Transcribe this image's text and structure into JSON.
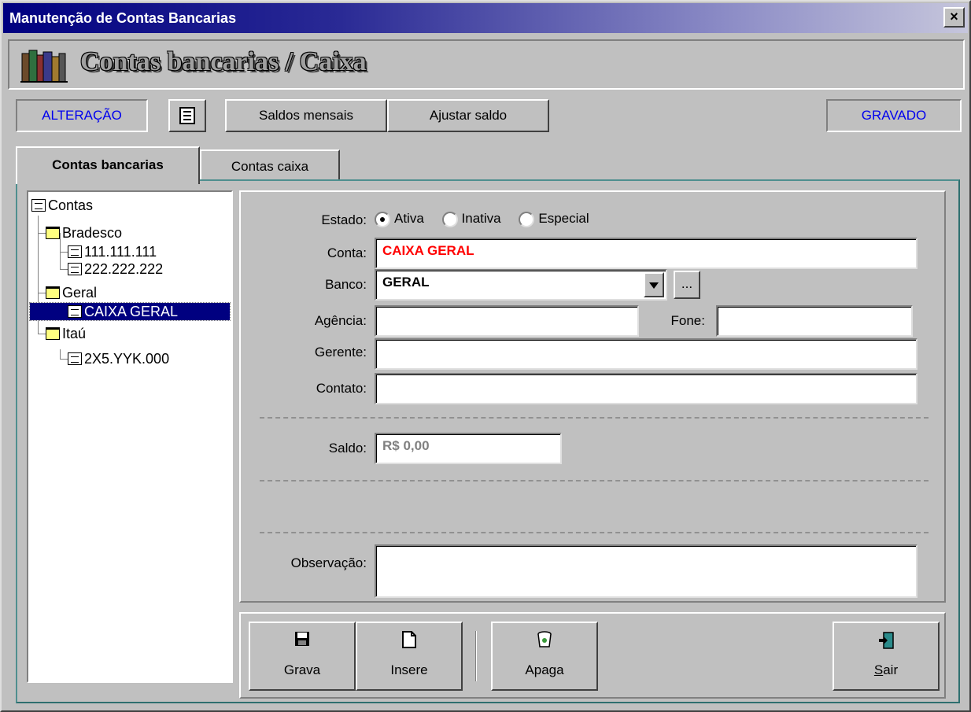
{
  "window": {
    "title": "Manutenção de Contas Bancarias",
    "close_label": "×"
  },
  "header": {
    "title": "Contas bancarias / Caixa",
    "icon": "books-icon"
  },
  "toolbar": {
    "mode": "ALTERAÇÃO",
    "list_icon": "list-icon",
    "saldos_label": "Saldos mensais",
    "ajustar_label": "Ajustar saldo",
    "status": "GRAVADO"
  },
  "tabs": [
    {
      "label": "Contas bancarias",
      "active": true
    },
    {
      "label": "Contas caixa",
      "active": false
    }
  ],
  "tree": {
    "root": "Contas",
    "groups": [
      {
        "label": "Bradesco",
        "children": [
          "111.111.111",
          "222.222.222"
        ]
      },
      {
        "label": "Geral",
        "children": [
          "CAIXA GERAL"
        ]
      },
      {
        "label": "Itaú",
        "children": [
          "2X5.YYK.000"
        ]
      }
    ],
    "selected": "CAIXA GERAL"
  },
  "form": {
    "estado_label": "Estado:",
    "estado_options": [
      {
        "label": "Ativa",
        "checked": true
      },
      {
        "label": "Inativa",
        "checked": false
      },
      {
        "label": "Especial",
        "checked": false
      }
    ],
    "conta_label": "Conta:",
    "conta_value": "CAIXA GERAL",
    "conta_color": "#ff0000",
    "banco_label": "Banco:",
    "banco_value": "GERAL",
    "banco_more": "...",
    "agencia_label": "Agência:",
    "agencia_value": "",
    "fone_label": "Fone:",
    "fone_value": "",
    "gerente_label": "Gerente:",
    "gerente_value": "",
    "contato_label": "Contato:",
    "contato_value": "",
    "saldo_label": "Saldo:",
    "saldo_value": "R$ 0,00",
    "observacao_label": "Observação:",
    "observacao_value": ""
  },
  "actions": {
    "grava": {
      "label": "Grava",
      "icon": "floppy-disk-icon"
    },
    "insere": {
      "label": "Insere",
      "icon": "new-document-icon"
    },
    "apaga": {
      "label": "Apaga",
      "icon": "trash-can-icon"
    },
    "sair": {
      "label_first": "S",
      "label_rest": "air",
      "icon": "exit-door-icon"
    }
  },
  "colors": {
    "title_gradient_start": "#000080",
    "mode_text": "#0000ee",
    "panel_border": "#2e6f6f"
  }
}
